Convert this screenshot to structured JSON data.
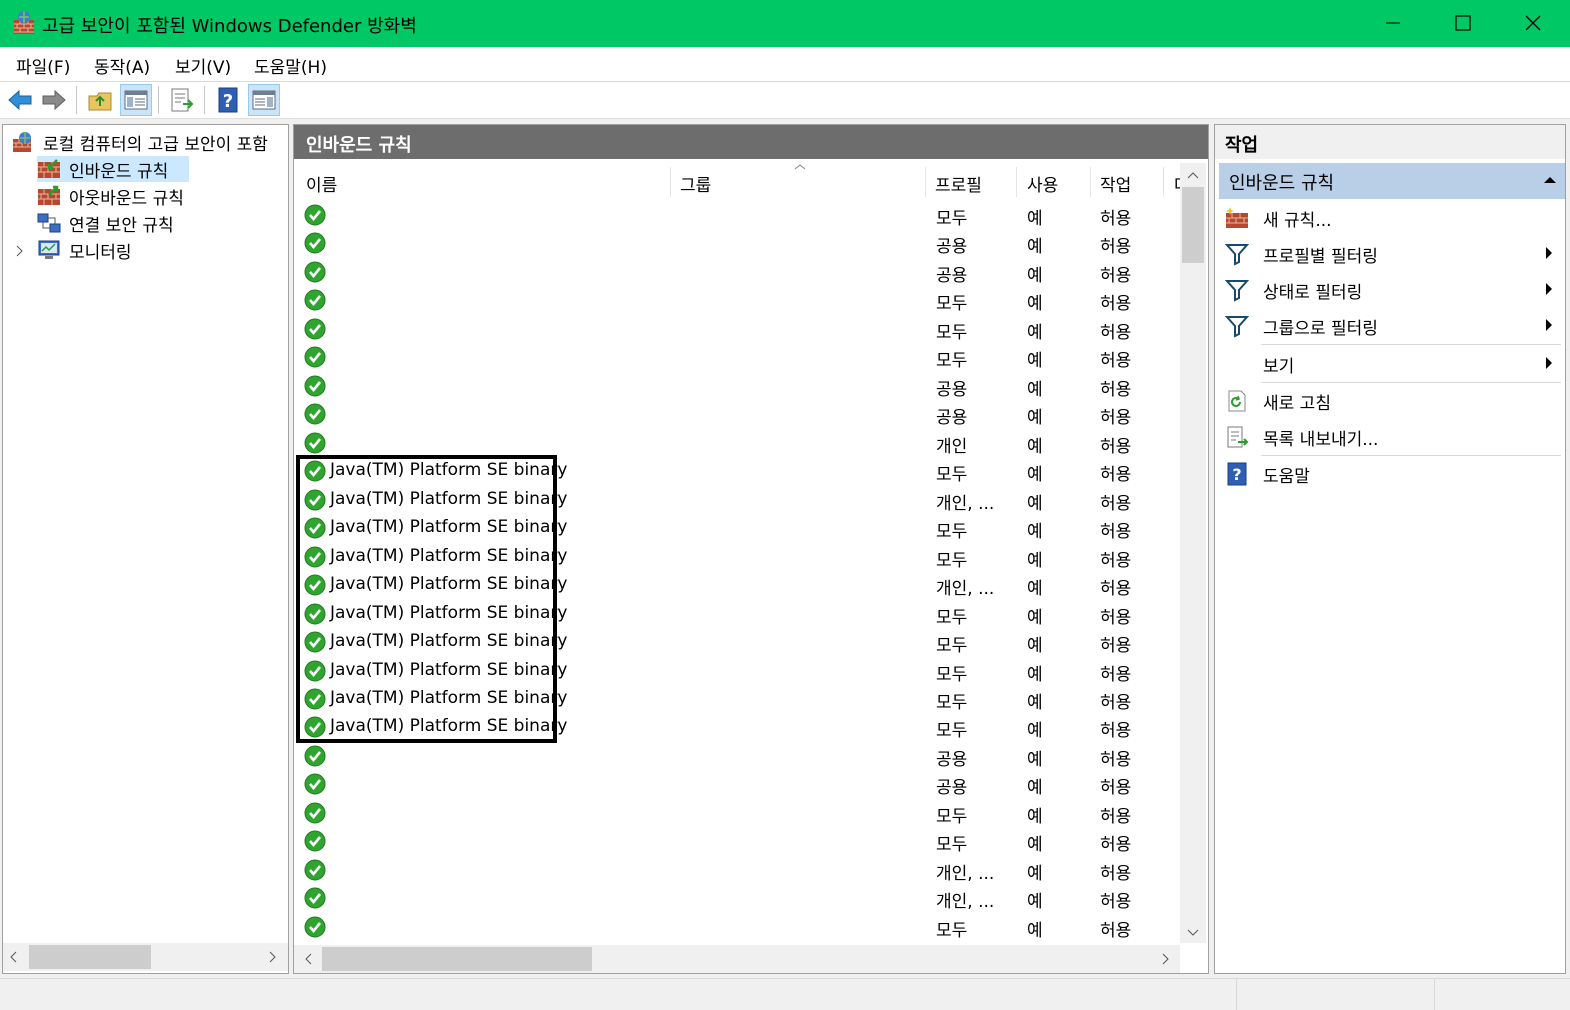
{
  "window": {
    "title": "고급 보안이 포함된 Windows Defender 방화벽",
    "title_bar_color": "#00c864"
  },
  "menu": {
    "items": [
      "파일(F)",
      "동작(A)",
      "보기(V)",
      "도움말(H)"
    ]
  },
  "toolbar": {
    "buttons": [
      "back-arrow-icon",
      "forward-arrow-icon",
      "up-folder-icon",
      "show-hide-tree-icon",
      "export-list-icon",
      "help-icon",
      "show-hide-action-pane-icon"
    ]
  },
  "tree": {
    "root": "로컬 컴퓨터의 고급 보안이 포함",
    "items": [
      "인바운드 규칙",
      "아웃바운드 규칙",
      "연결 보안 규칙",
      "모니터링"
    ]
  },
  "center": {
    "title": "인바운드 규칙",
    "columns": [
      "이름",
      "그룹",
      "프로필",
      "사용",
      "작업",
      "다"
    ],
    "rows": [
      {
        "name": "",
        "profile": "모두",
        "enabled": "예",
        "action": "허용"
      },
      {
        "name": "",
        "profile": "공용",
        "enabled": "예",
        "action": "허용"
      },
      {
        "name": "",
        "profile": "공용",
        "enabled": "예",
        "action": "허용"
      },
      {
        "name": "",
        "profile": "모두",
        "enabled": "예",
        "action": "허용"
      },
      {
        "name": "",
        "profile": "모두",
        "enabled": "예",
        "action": "허용"
      },
      {
        "name": "",
        "profile": "모두",
        "enabled": "예",
        "action": "허용"
      },
      {
        "name": "",
        "profile": "공용",
        "enabled": "예",
        "action": "허용"
      },
      {
        "name": "",
        "profile": "공용",
        "enabled": "예",
        "action": "허용"
      },
      {
        "name": "",
        "profile": "개인",
        "enabled": "예",
        "action": "허용"
      },
      {
        "name": "Java(TM) Platform SE binary",
        "profile": "모두",
        "enabled": "예",
        "action": "허용"
      },
      {
        "name": "Java(TM) Platform SE binary",
        "profile": "개인, ...",
        "enabled": "예",
        "action": "허용"
      },
      {
        "name": "Java(TM) Platform SE binary",
        "profile": "모두",
        "enabled": "예",
        "action": "허용"
      },
      {
        "name": "Java(TM) Platform SE binary",
        "profile": "모두",
        "enabled": "예",
        "action": "허용"
      },
      {
        "name": "Java(TM) Platform SE binary",
        "profile": "개인, ...",
        "enabled": "예",
        "action": "허용"
      },
      {
        "name": "Java(TM) Platform SE binary",
        "profile": "모두",
        "enabled": "예",
        "action": "허용"
      },
      {
        "name": "Java(TM) Platform SE binary",
        "profile": "모두",
        "enabled": "예",
        "action": "허용"
      },
      {
        "name": "Java(TM) Platform SE binary",
        "profile": "모두",
        "enabled": "예",
        "action": "허용"
      },
      {
        "name": "Java(TM) Platform SE binary",
        "profile": "모두",
        "enabled": "예",
        "action": "허용"
      },
      {
        "name": "Java(TM) Platform SE binary",
        "profile": "모두",
        "enabled": "예",
        "action": "허용"
      },
      {
        "name": "",
        "profile": "공용",
        "enabled": "예",
        "action": "허용"
      },
      {
        "name": "",
        "profile": "공용",
        "enabled": "예",
        "action": "허용"
      },
      {
        "name": "",
        "profile": "모두",
        "enabled": "예",
        "action": "허용"
      },
      {
        "name": "",
        "profile": "모두",
        "enabled": "예",
        "action": "허용"
      },
      {
        "name": "",
        "profile": "개인, ...",
        "enabled": "예",
        "action": "허용"
      },
      {
        "name": "",
        "profile": "개인, ...",
        "enabled": "예",
        "action": "허용"
      },
      {
        "name": "",
        "profile": "모두",
        "enabled": "예",
        "action": "허용"
      }
    ]
  },
  "actions": {
    "title": "작업",
    "section": "인바운드 규칙",
    "items": [
      {
        "label": "새 규칙...",
        "icon": "new-rule-icon",
        "arrow": false
      },
      {
        "label": "프로필별 필터링",
        "icon": "filter-icon",
        "arrow": true
      },
      {
        "label": "상태로 필터링",
        "icon": "filter-icon",
        "arrow": true
      },
      {
        "label": "그룹으로 필터링",
        "icon": "filter-icon",
        "arrow": true
      },
      {
        "label": "보기",
        "icon": "",
        "arrow": true
      },
      {
        "label": "새로 고침",
        "icon": "refresh-icon",
        "arrow": false
      },
      {
        "label": "목록 내보내기...",
        "icon": "export-list-icon",
        "arrow": false
      },
      {
        "label": "도움말",
        "icon": "help-icon",
        "arrow": false
      }
    ]
  }
}
